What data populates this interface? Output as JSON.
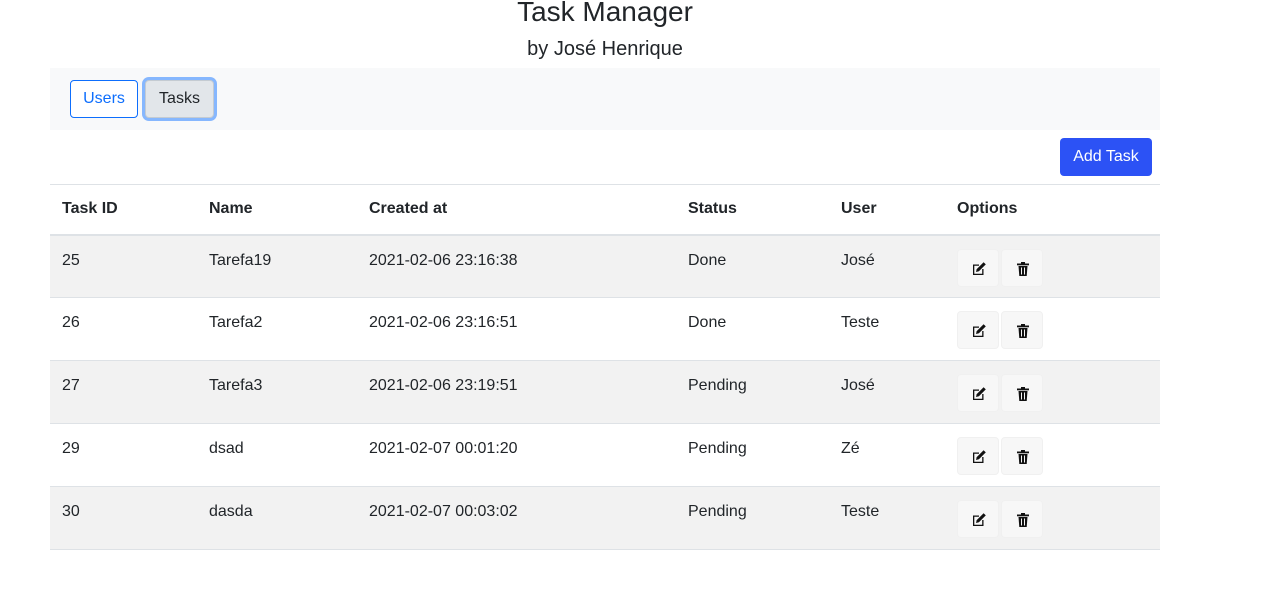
{
  "header": {
    "title": "Task Manager",
    "subtitle": "by José Henrique"
  },
  "nav": {
    "users_label": "Users",
    "tasks_label": "Tasks",
    "active": "Tasks"
  },
  "toolbar": {
    "add_task_label": "Add Task"
  },
  "table": {
    "columns": [
      "Task ID",
      "Name",
      "Created at",
      "Status",
      "User",
      "Options"
    ],
    "rows": [
      {
        "id": "25",
        "name": "Tarefa19",
        "created_at": "2021-02-06 23:16:38",
        "status": "Done",
        "user": "José"
      },
      {
        "id": "26",
        "name": "Tarefa2",
        "created_at": "2021-02-06 23:16:51",
        "status": "Done",
        "user": "Teste"
      },
      {
        "id": "27",
        "name": "Tarefa3",
        "created_at": "2021-02-06 23:19:51",
        "status": "Pending",
        "user": "José"
      },
      {
        "id": "29",
        "name": "dsad",
        "created_at": "2021-02-07 00:01:20",
        "status": "Pending",
        "user": "Zé"
      },
      {
        "id": "30",
        "name": "dasda",
        "created_at": "2021-02-07 00:03:02",
        "status": "Pending",
        "user": "Teste"
      }
    ],
    "row_actions": [
      {
        "icon": "edit-icon"
      },
      {
        "icon": "trash-icon"
      }
    ]
  },
  "colors": {
    "primary": "#2c52f5",
    "link": "#0d6efd",
    "navbar_bg": "#f8f9fa",
    "stripe": "#f2f2f2"
  }
}
